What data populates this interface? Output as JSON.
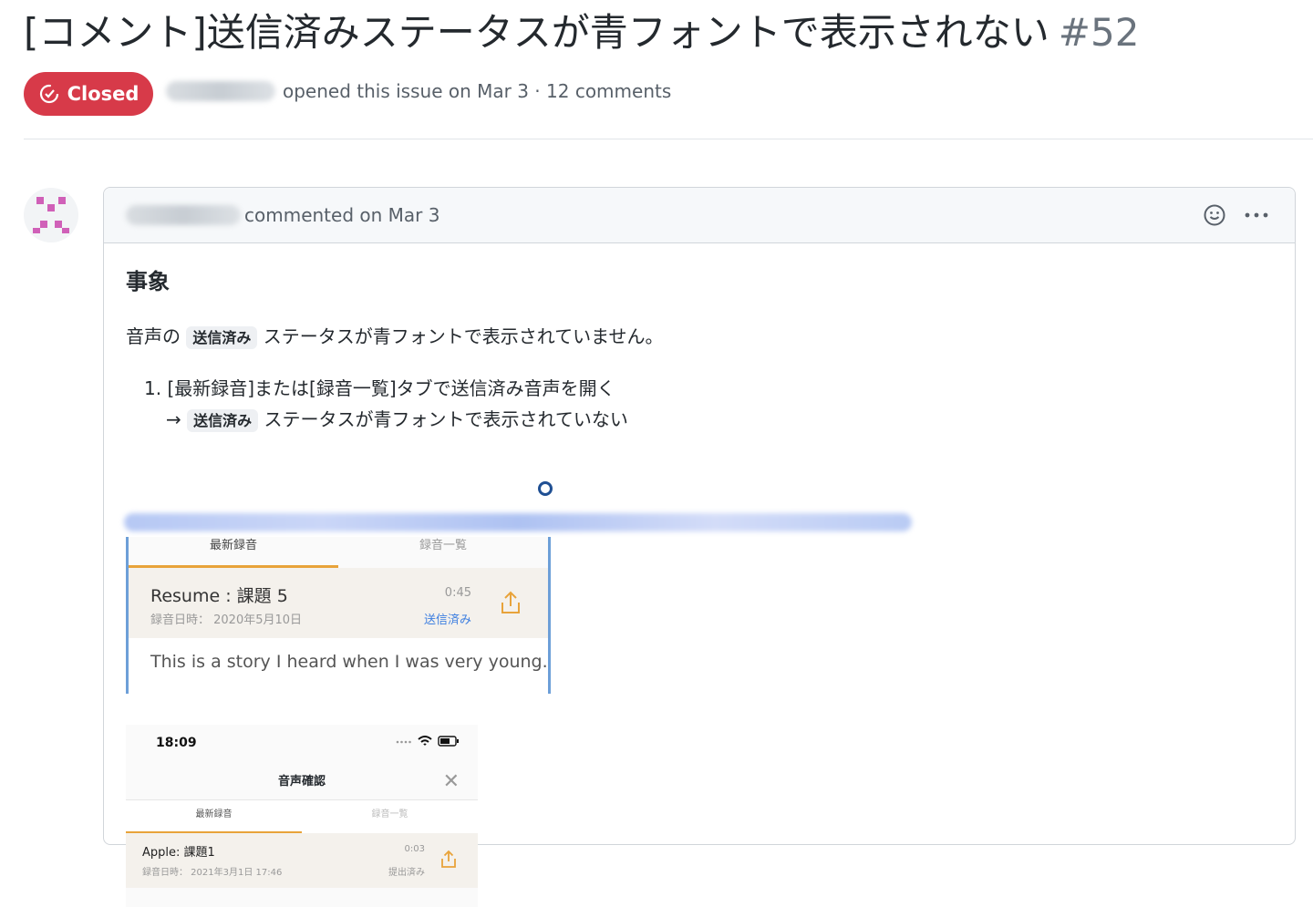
{
  "issue": {
    "title": "[コメント]送信済みステータスが青フォントで表示されない",
    "number": "#52",
    "state_label": "Closed",
    "meta_text": "opened this issue on Mar 3 · 12 comments"
  },
  "comment": {
    "header_text": "commented on Mar 3",
    "heading": "事象",
    "para_before": "音声の",
    "para_code": "送信済み",
    "para_after": "ステータスが青フォントで表示されていません。",
    "list_item": "1. [最新録音]または[録音一覧]タブで送信済み音声を開く",
    "list_arrow": "→",
    "list_code": "送信済み",
    "list_after": "ステータスが青フォントで表示されていない"
  },
  "shot1": {
    "tab_latest": "最新録音",
    "tab_list": "録音一覧",
    "rec_title": "Resume : 課題 5",
    "rec_date": "録音日時： 2020年5月10日",
    "rec_duration": "0:45",
    "rec_status": "送信済み",
    "story": "This is a story I heard when I was very young."
  },
  "shot2": {
    "time": "18:09",
    "nav_title": "音声確認",
    "tab_latest": "最新録音",
    "tab_list": "録音一覧",
    "rec_title": "Apple: 課題1",
    "rec_date": "録音日時： 2021年3月1日 17:46",
    "rec_duration": "0:03",
    "rec_status": "提出済み"
  },
  "colors": {
    "closed_badge": "#d73a49",
    "sent_status_blue": "#3d7fe0",
    "tab_underline": "#e8a33a"
  }
}
